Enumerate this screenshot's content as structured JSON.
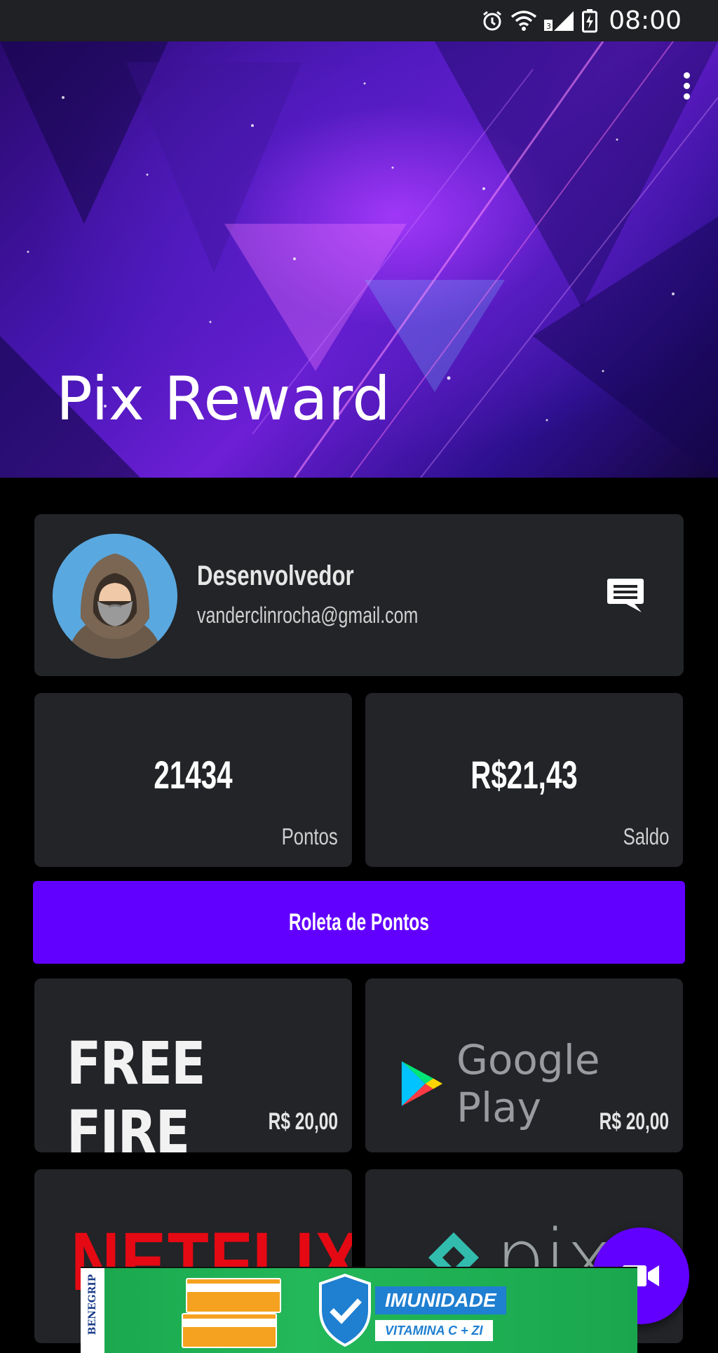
{
  "status_bar": {
    "time": "08:00",
    "icons": [
      "alarm-icon",
      "wifi-icon",
      "signal-icon",
      "battery-charging-icon"
    ]
  },
  "header": {
    "title": "Pix Reward",
    "menu_icon": "more-vert-icon"
  },
  "profile": {
    "name": "Desenvolvedor",
    "email": "vanderclinrocha@gmail.com",
    "action_icon": "chat-icon"
  },
  "stats": {
    "points": {
      "value": "21434",
      "label": "Pontos"
    },
    "balance": {
      "value": "R$21,43",
      "label": "Saldo"
    }
  },
  "roleta": {
    "label": "Roleta de Pontos"
  },
  "rewards": [
    {
      "brand": "FREE FIRE",
      "price": "R$ 20,00"
    },
    {
      "brand": "Google Play",
      "price": "R$ 20,00"
    },
    {
      "brand": "NETFLIX",
      "price": ""
    },
    {
      "brand": "pix",
      "price": ""
    }
  ],
  "fab": {
    "icon": "video-camera-icon"
  },
  "ad": {
    "brand": "BENEGRIP",
    "title": "IMUNIDADE",
    "subtitle": "VITAMINA C + ZI"
  },
  "colors": {
    "accent": "#6200ff",
    "card": "#222427",
    "background": "#000000",
    "status_bar": "#1f2124",
    "netflix_red": "#e50914"
  }
}
